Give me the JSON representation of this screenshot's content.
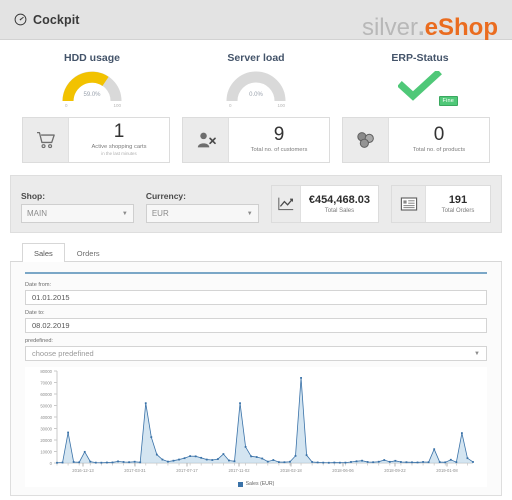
{
  "topbar": {
    "icon": "gauge-icon",
    "title": "Cockpit",
    "brand_prefix": "silver",
    "brand_dot": ".",
    "brand_suffix": "eShop"
  },
  "gauges": [
    {
      "title": "HDD usage",
      "value_text": "59.0%",
      "value": 59,
      "min": "0",
      "max": "100",
      "color": "#f2c200"
    },
    {
      "title": "Server load",
      "value_text": "0.0%",
      "value": 0,
      "min": "0",
      "max": "100",
      "color": "#cccccc"
    },
    {
      "title": "ERP-Status",
      "badge": "Fine",
      "icon": "check-icon",
      "color": "#4fc878"
    }
  ],
  "stats": [
    {
      "icon": "shopping-cart-icon",
      "value": "1",
      "label": "Active shopping carts",
      "sub": "in the last minutes"
    },
    {
      "icon": "user-remove-icon",
      "value": "9",
      "label": "Total no. of customers",
      "sub": ""
    },
    {
      "icon": "products-icon",
      "value": "0",
      "label": "Total no. of products",
      "sub": ""
    }
  ],
  "filters": {
    "shop": {
      "label": "Shop:",
      "value": "MAIN"
    },
    "currency": {
      "label": "Currency:",
      "value": "EUR"
    },
    "total_sales": {
      "icon": "line-chart-icon",
      "value": "€454,468.03",
      "label": "Total Sales"
    },
    "total_orders": {
      "icon": "list-icon",
      "value": "191",
      "label": "Total Orders"
    }
  },
  "tabs": [
    {
      "label": "Sales",
      "active": true
    },
    {
      "label": "Orders",
      "active": false
    }
  ],
  "form": {
    "date_from": {
      "label": "Date from:",
      "value": "01.01.2015"
    },
    "date_to": {
      "label": "Date to:",
      "value": "08.02.2019"
    },
    "predefined": {
      "label": "predefined:",
      "value": "choose predefined"
    }
  },
  "chart_data": {
    "type": "area",
    "title": "",
    "xlabel": "",
    "ylabel": "",
    "ylim": [
      0,
      80000
    ],
    "yticks": [
      0,
      10000,
      20000,
      30000,
      40000,
      50000,
      60000,
      70000,
      80000
    ],
    "ytick_labels": [
      "0",
      "10000",
      "20000",
      "30000",
      "40000",
      "50000",
      "60000",
      "70000",
      "80000"
    ],
    "xtick_labels": [
      "2016-12-13",
      "2017-03-31",
      "2017-07-17",
      "2017-11-02",
      "2018-02-18",
      "2018-06-06",
      "2018-09-22",
      "2019-01-08"
    ],
    "grid": false,
    "legend_position": "bottom",
    "series": [
      {
        "name": "Sales (EUR)",
        "color": "#3a72a8",
        "fill": "#bdd7ea",
        "values": [
          200,
          400,
          26500,
          900,
          600,
          9700,
          1200,
          300,
          250,
          400,
          500,
          1400,
          900,
          700,
          1100,
          600,
          52000,
          22500,
          7300,
          3000,
          1200,
          2000,
          3000,
          4200,
          6000,
          5800,
          4500,
          3000,
          2600,
          3400,
          7800,
          2200,
          1500,
          52000,
          14000,
          5800,
          5200,
          3900,
          1200,
          2600,
          800,
          700,
          1100,
          6200,
          74000,
          6800,
          900,
          500,
          300,
          200,
          400,
          260,
          300,
          900,
          1500,
          2000,
          900,
          700,
          1100,
          2600,
          1000,
          1900,
          900,
          700,
          600,
          500,
          900,
          700,
          12000,
          800,
          600,
          2800,
          700,
          26000,
          4200,
          900
        ]
      }
    ]
  },
  "legend": {
    "swatch_color": "#3a72a8",
    "text": "Sales (EUR)"
  }
}
